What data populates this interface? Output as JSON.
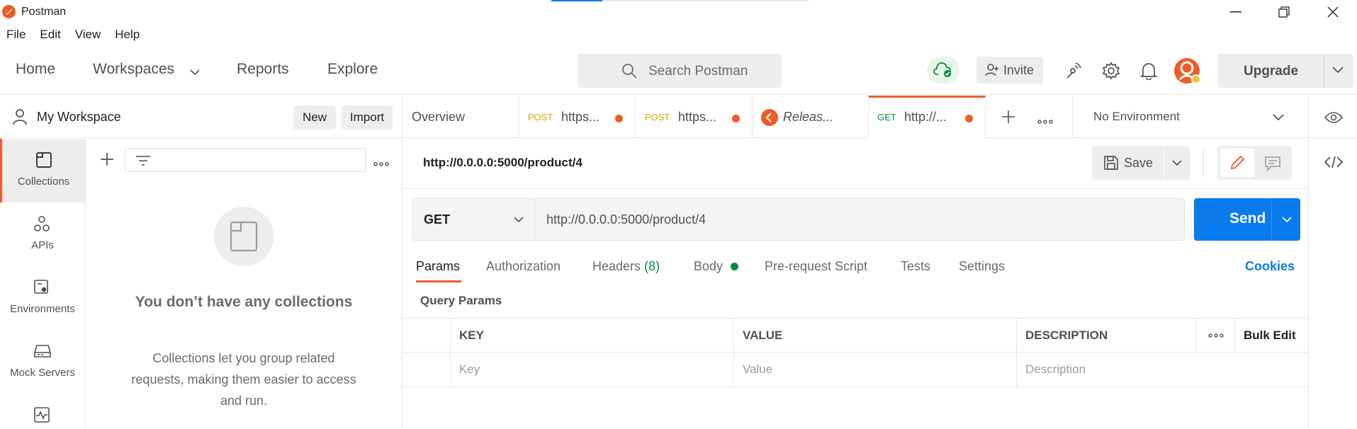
{
  "window": {
    "title": "Postman"
  },
  "menu": [
    "File",
    "Edit",
    "View",
    "Help"
  ],
  "header": {
    "nav": [
      "Home",
      "Workspaces",
      "Reports",
      "Explore"
    ],
    "search_placeholder": "Search Postman",
    "invite_label": "Invite",
    "upgrade_label": "Upgrade",
    "accent": "#ef5b25"
  },
  "workspace": {
    "title": "My Workspace",
    "new_label": "New",
    "import_label": "Import"
  },
  "leftrail": [
    {
      "label": "Collections",
      "icon": "collections-icon"
    },
    {
      "label": "APIs",
      "icon": "apis-icon"
    },
    {
      "label": "Environments",
      "icon": "environments-icon"
    },
    {
      "label": "Mock Servers",
      "icon": "mock-servers-icon"
    }
  ],
  "collections_empty": {
    "title": "You don’t have any collections",
    "description": "Collections let you group related requests, making them easier to access and run."
  },
  "tabs": [
    {
      "label": "Overview"
    },
    {
      "method": "POST",
      "label": "https...",
      "method_color": "#d9a406"
    },
    {
      "method": "POST",
      "label": "https...",
      "method_color": "#d9a406"
    },
    {
      "label": "Releas..."
    },
    {
      "method": "GET",
      "label": "http://...",
      "method_color": "#0a8a3a"
    }
  ],
  "environment": {
    "label": "No Environment"
  },
  "request": {
    "title": "http://0.0.0.0:5000/product/4",
    "save_label": "Save",
    "method": "GET",
    "url": "http://0.0.0.0:5000/product/4",
    "send_label": "Send",
    "send_color": "#097bed"
  },
  "request_tabs": {
    "params": "Params",
    "authorization": "Authorization",
    "headers": "Headers",
    "headers_count": "(8)",
    "body": "Body",
    "prerequest": "Pre-request Script",
    "tests": "Tests",
    "settings": "Settings",
    "cookies": "Cookies"
  },
  "query_params": {
    "title": "Query Params",
    "columns": [
      "KEY",
      "VALUE",
      "DESCRIPTION"
    ],
    "bulk_edit": "Bulk Edit",
    "placeholders": [
      "Key",
      "Value",
      "Description"
    ]
  }
}
